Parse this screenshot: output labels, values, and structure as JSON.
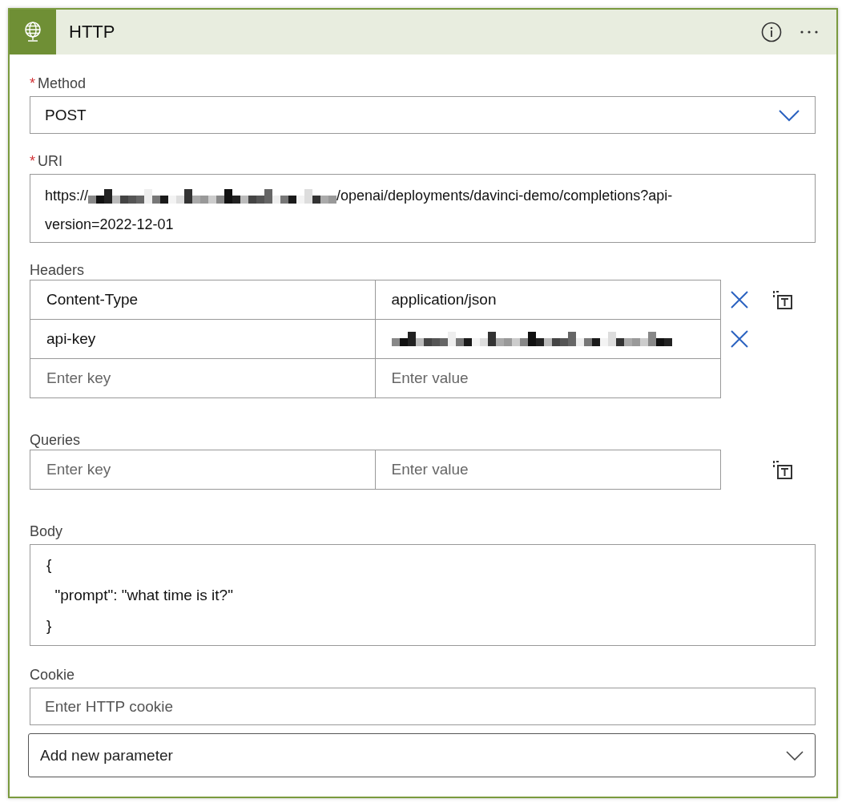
{
  "card": {
    "title": "HTTP"
  },
  "method": {
    "marker": "*",
    "label": "Method",
    "value": "POST"
  },
  "uri": {
    "marker": "*",
    "label": "URI",
    "prefix": "https://",
    "host_redacted": true,
    "suffix": "/openai/deployments/davinci-demo/completions?api-version=2022-12-01"
  },
  "headers": {
    "label": "Headers",
    "rows": [
      {
        "key": "Content-Type",
        "value": "application/json",
        "redacted": false,
        "removable": true,
        "switchable": true
      },
      {
        "key": "api-key",
        "value": "",
        "redacted": true,
        "removable": true,
        "switchable": false
      }
    ],
    "key_placeholder": "Enter key",
    "value_placeholder": "Enter value"
  },
  "queries": {
    "label": "Queries",
    "key_placeholder": "Enter key",
    "value_placeholder": "Enter value"
  },
  "body": {
    "label": "Body",
    "lines": [
      "{",
      "  \"prompt\": \"what time is it?\"",
      "}"
    ]
  },
  "cookie": {
    "label": "Cookie",
    "placeholder": "Enter HTTP cookie"
  },
  "add_parameter": {
    "label": "Add new parameter"
  }
}
